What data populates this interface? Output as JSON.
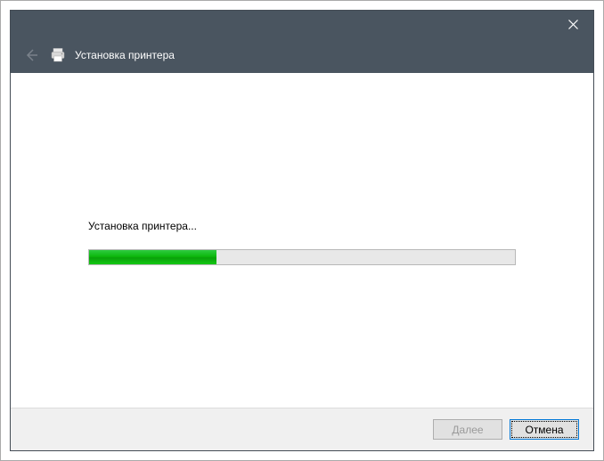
{
  "header": {
    "title": "Установка принтера"
  },
  "content": {
    "status_text": "Установка принтера...",
    "progress_percent": 30
  },
  "footer": {
    "next_prefix": "Д",
    "next_suffix": "алее",
    "cancel_label": "Отмена"
  }
}
